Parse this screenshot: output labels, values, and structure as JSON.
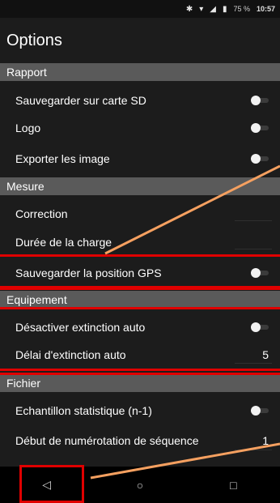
{
  "status_bar": {
    "icons": [
      "bluetooth-icon",
      "wifi-icon",
      "signal-icon",
      "battery-icon"
    ],
    "battery": "75 %",
    "time": "10:57"
  },
  "header": {
    "title": "Options"
  },
  "sections": {
    "rapport": {
      "title": "Rapport",
      "items": [
        {
          "label": "Sauvegarder sur carte SD",
          "toggle": false
        },
        {
          "label": "Logo",
          "toggle": false
        },
        {
          "label": "Exporter les image",
          "toggle": false
        }
      ]
    },
    "mesure": {
      "title": "Mesure",
      "items": [
        {
          "label": "Correction",
          "value": ""
        },
        {
          "label": "Durée de la charge",
          "value": ""
        },
        {
          "label": "Sauvegarder la position GPS",
          "toggle": false
        }
      ]
    },
    "equipement": {
      "title": "Equipement",
      "items": [
        {
          "label": "Désactiver extinction auto",
          "toggle": false
        },
        {
          "label": "Délai d'extinction auto",
          "value": "5"
        }
      ]
    },
    "fichier": {
      "title": "Fichier",
      "items": [
        {
          "label": "Echantillon statistique (n-1)",
          "toggle": false
        },
        {
          "label": "Début de numérotation de séquence",
          "value": "1"
        }
      ]
    }
  },
  "nav_bar": {
    "back": "◁",
    "home": "○",
    "recents": "□"
  },
  "colors": {
    "annotation_red": "#e00000",
    "annotation_orange": "#f5a060",
    "section_bg": "#5a5a5a",
    "page_bg": "#1c1c1c"
  }
}
